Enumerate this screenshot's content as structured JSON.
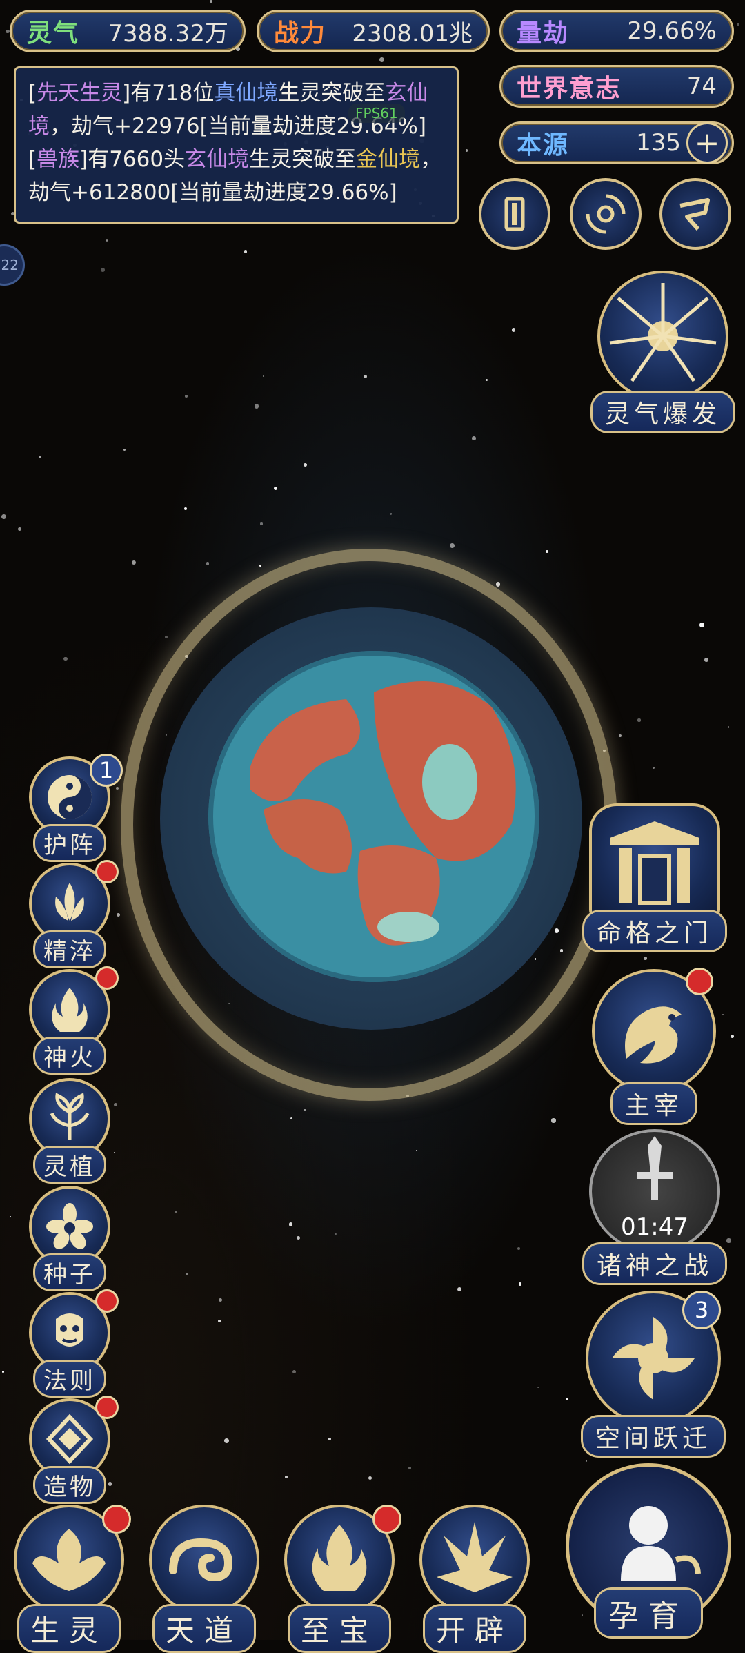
{
  "stats": {
    "lingqi": {
      "label": "灵气",
      "value": "7388.32万"
    },
    "zhanli": {
      "label": "战力",
      "value": "2308.01兆"
    },
    "liangjie": {
      "label": "量劫",
      "value": "29.66%"
    },
    "shijie_yizhi": {
      "label": "世界意志",
      "value": "74"
    },
    "benyuan": {
      "label": "本源",
      "value": "135",
      "plus": "+"
    }
  },
  "log": {
    "line1": {
      "p1": "[",
      "race": "先天生灵",
      "p2": "]有718位",
      "realm_from": "真仙境",
      "p3": "生灵突破至",
      "realm_to": "玄仙境",
      "p4": "，劫气+22976[当前量劫进度29.64%]"
    },
    "line2": {
      "p1": "[",
      "race": "兽族",
      "p2": "]有7660头",
      "realm_from": "玄仙境",
      "p3": "生灵突破至",
      "realm_to": "金仙境",
      "p4": "，劫气+612800[当前量劫进度29.66%]"
    },
    "fps": "FPS61"
  },
  "side_level": "22",
  "top_icons": [
    "cards-icon",
    "vortex-icon",
    "flag-icon"
  ],
  "burst_button": {
    "label": "灵气爆发"
  },
  "left_buttons": [
    {
      "label": "护阵",
      "badge": "1"
    },
    {
      "label": "精淬"
    },
    {
      "label": "神火"
    },
    {
      "label": "灵植"
    },
    {
      "label": "种子"
    },
    {
      "label": "法则"
    },
    {
      "label": "造物"
    }
  ],
  "right_buttons": [
    {
      "label": "命格之门"
    },
    {
      "label": "主宰"
    },
    {
      "label": "诸神之战",
      "timer": "01:47"
    },
    {
      "label": "空间跃迁",
      "badge": "3"
    }
  ],
  "bottom_nav": [
    {
      "label": "生灵"
    },
    {
      "label": "天道"
    },
    {
      "label": "至宝"
    },
    {
      "label": "开辟"
    },
    {
      "label": "孕育"
    }
  ],
  "colors": {
    "gold": "#d8c189",
    "navy": "#1a2f60",
    "alert": "#d52b2b"
  }
}
